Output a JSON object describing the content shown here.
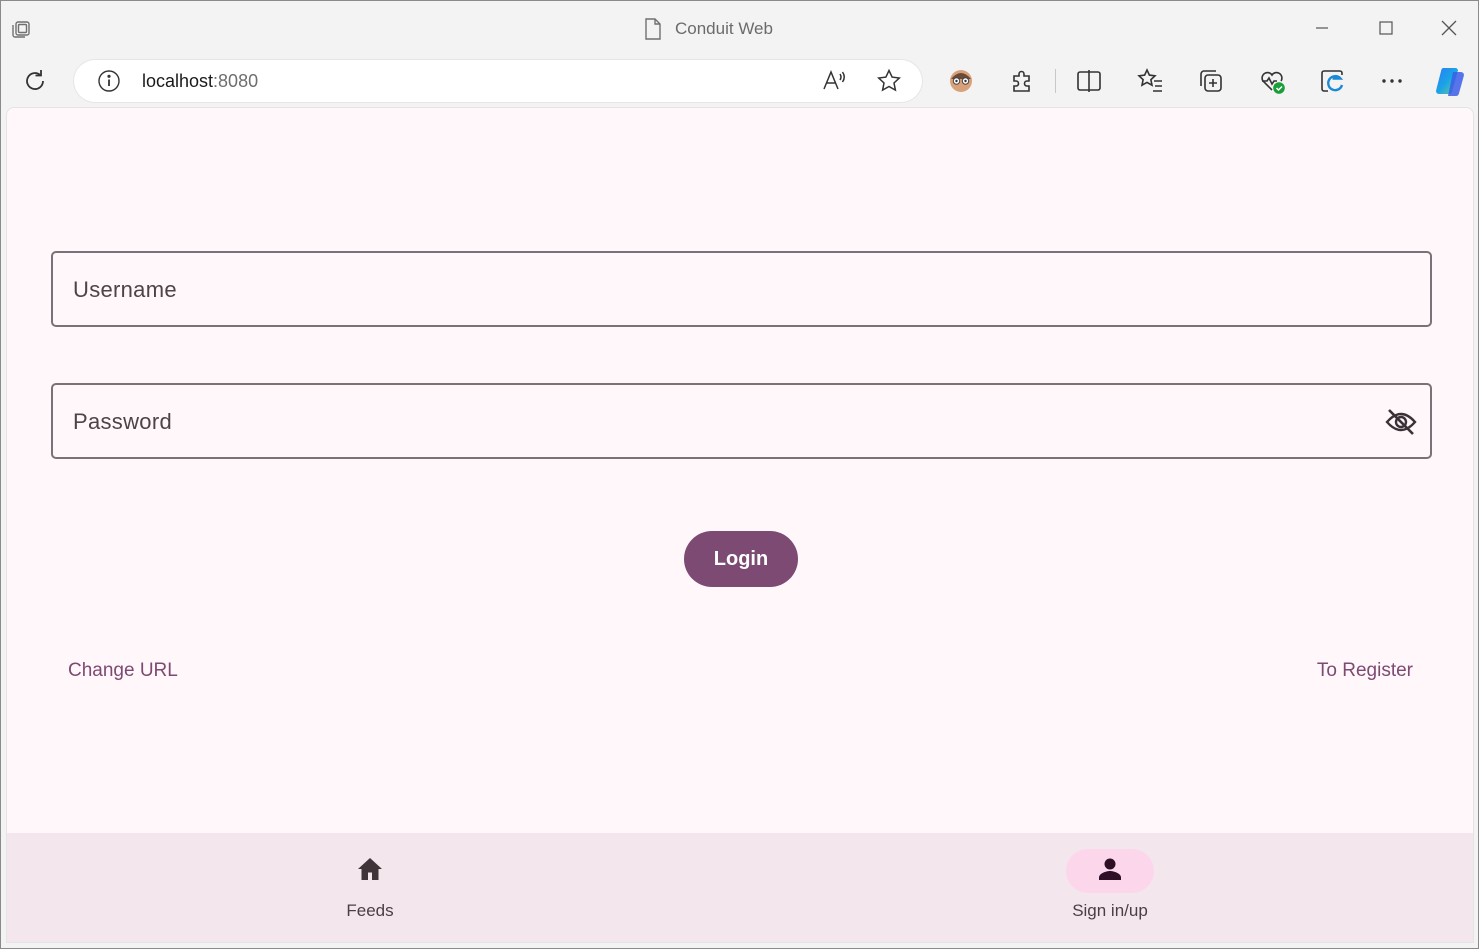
{
  "browser": {
    "window_title": "Conduit Web",
    "url_host": "localhost",
    "url_port": ":8080"
  },
  "form": {
    "username_placeholder": "Username",
    "password_placeholder": "Password",
    "login_label": "Login"
  },
  "links": {
    "change_url": "Change URL",
    "to_register": "To Register"
  },
  "nav": {
    "items": [
      {
        "label": "Feeds",
        "icon": "home-icon",
        "active": false
      },
      {
        "label": "Sign in/up",
        "icon": "person-icon",
        "active": true
      }
    ]
  },
  "colors": {
    "primary": "#7d4a73",
    "background": "#fff7f9",
    "nav_background": "#f4e6ed",
    "active_pill": "#fcd7eb"
  }
}
